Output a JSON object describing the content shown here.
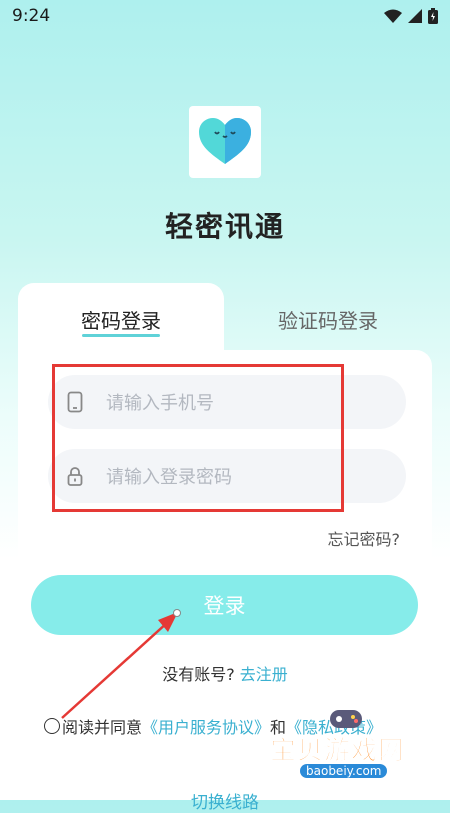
{
  "status_bar": {
    "time": "9:24"
  },
  "app": {
    "title": "轻密讯通"
  },
  "tabs": {
    "password_login": "密码登录",
    "code_login": "验证码登录"
  },
  "form": {
    "phone_placeholder": "请输入手机号",
    "password_placeholder": "请输入登录密码",
    "phone_icon": "phone-icon",
    "lock_icon": "lock-icon",
    "forgot_password": "忘记密码?"
  },
  "login_button": "登录",
  "register": {
    "prompt": "没有账号?",
    "link": "去注册"
  },
  "agreement": {
    "prefix": "阅读并同意",
    "user_agreement": "《用户服务协议》",
    "and": "和",
    "privacy_policy": "《隐私政策》"
  },
  "switch_line": "切换线路",
  "watermark": {
    "name": "宝贝游戏网",
    "url": "baobeiy.com"
  },
  "colors": {
    "accent": "#86ecea",
    "link": "#3ab0d0",
    "annotation": "#e53935"
  }
}
